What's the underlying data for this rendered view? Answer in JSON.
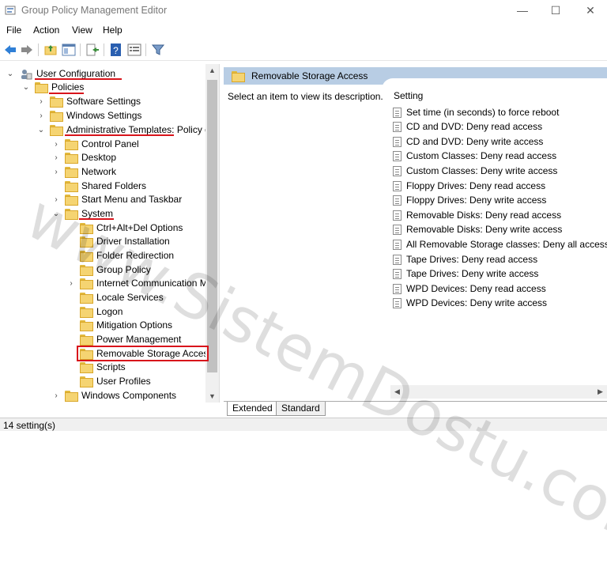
{
  "window": {
    "title": "Group Policy Management Editor",
    "minimize_glyph": "—",
    "maximize_glyph": "☐",
    "close_glyph": "✕"
  },
  "menu": [
    "File",
    "Action",
    "View",
    "Help"
  ],
  "toolbar_icons": [
    "back-arrow-icon",
    "forward-arrow-icon",
    "up-folder-icon",
    "show-hide-tree-icon",
    "export-list-icon",
    "help-icon",
    "properties-icon",
    "filter-icon"
  ],
  "tree": [
    {
      "label": "User Configuration",
      "expanded": true
    },
    {
      "label": "Policies",
      "expanded": true
    },
    {
      "label": "Software Settings",
      "expanded": false
    },
    {
      "label": "Windows Settings",
      "expanded": false
    },
    {
      "label": "Administrative Templates: Policy d",
      "expanded": true
    },
    {
      "label": "Control Panel",
      "expanded": false
    },
    {
      "label": "Desktop",
      "expanded": false
    },
    {
      "label": "Network",
      "expanded": false
    },
    {
      "label": "Shared Folders",
      "expanded": null
    },
    {
      "label": "Start Menu and Taskbar",
      "expanded": false
    },
    {
      "label": "System",
      "expanded": true
    },
    {
      "label": "Ctrl+Alt+Del Options",
      "expanded": null
    },
    {
      "label": "Driver Installation",
      "expanded": null
    },
    {
      "label": "Folder Redirection",
      "expanded": null
    },
    {
      "label": "Group Policy",
      "expanded": null
    },
    {
      "label": "Internet Communication M",
      "expanded": false
    },
    {
      "label": "Locale Services",
      "expanded": null
    },
    {
      "label": "Logon",
      "expanded": null
    },
    {
      "label": "Mitigation Options",
      "expanded": null
    },
    {
      "label": "Power Management",
      "expanded": null
    },
    {
      "label": "Removable Storage Access",
      "expanded": null,
      "selected": true
    },
    {
      "label": "Scripts",
      "expanded": null
    },
    {
      "label": "User Profiles",
      "expanded": null
    },
    {
      "label": "Windows Components",
      "expanded": false
    }
  ],
  "right": {
    "header": "Removable Storage Access",
    "description": "Select an item to view its description.",
    "column_header": "Setting",
    "settings": [
      "Set time (in seconds) to force reboot",
      "CD and DVD: Deny read access",
      "CD and DVD: Deny write access",
      "Custom Classes: Deny read access",
      "Custom Classes: Deny write access",
      "Floppy Drives: Deny read access",
      "Floppy Drives: Deny write access",
      "Removable Disks: Deny read access",
      "Removable Disks: Deny write access",
      "All Removable Storage classes: Deny all access",
      "Tape Drives: Deny read access",
      "Tape Drives: Deny write access",
      "WPD Devices: Deny read access",
      "WPD Devices: Deny write access"
    ]
  },
  "tabs": [
    "Extended",
    "Standard"
  ],
  "status": "14 setting(s)",
  "watermark": "www.SistemDostu.com",
  "colors": {
    "highlight": "#d8141b",
    "header": "#b8cde4"
  }
}
